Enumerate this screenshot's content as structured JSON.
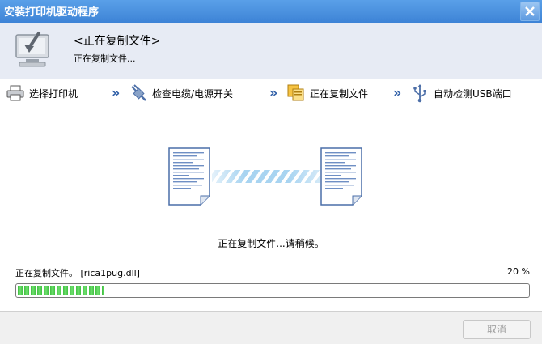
{
  "window": {
    "title": "安装打印机驱动程序"
  },
  "header": {
    "title": "<正在复制文件>",
    "subtitle": "正在复制文件..."
  },
  "steps": [
    {
      "label": "选择打印机",
      "icon": "printer-icon"
    },
    {
      "label": "检查电缆/电源开关",
      "icon": "power-plug-icon"
    },
    {
      "label": "正在复制文件",
      "icon": "copy-files-icon"
    },
    {
      "label": "自动检测USB端口",
      "icon": "usb-icon"
    }
  ],
  "status": {
    "waiting_text": "正在复制文件...请稍候。",
    "file_text": "正在复制文件。 [rica1pug.dll]",
    "percent_text": "20 %",
    "progress_fraction": 0.2
  },
  "footer": {
    "cancel_label": "取消"
  },
  "colors": {
    "titlebar": "#3d83d6",
    "progress": "#3fbe3f",
    "header_bg": "#e7ebf4"
  }
}
